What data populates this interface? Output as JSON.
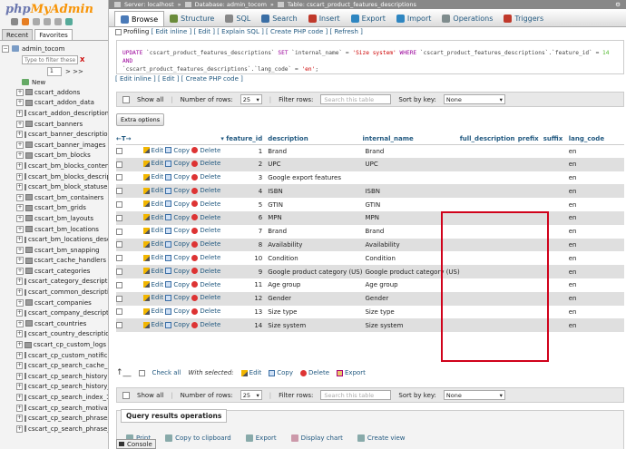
{
  "brand": {
    "name_a": "php",
    "name_b": "MyAdmin"
  },
  "nav": {
    "tabs": [
      "Recent",
      "Favorites"
    ],
    "db_name": "admin_tocom",
    "filter_placeholder": "Type to filter these, Ente",
    "filter_clear": "X",
    "page_select": "1",
    "page_next": "> >>",
    "new_label": "New",
    "tables": [
      "cscart_addons",
      "cscart_addon_data",
      "cscart_addon_descriptions",
      "cscart_banners",
      "cscart_banner_descriptions",
      "cscart_banner_images",
      "cscart_bm_blocks",
      "cscart_bm_blocks_content",
      "cscart_bm_blocks_descrip",
      "cscart_bm_block_statuses",
      "cscart_bm_containers",
      "cscart_bm_grids",
      "cscart_bm_layouts",
      "cscart_bm_locations",
      "cscart_bm_locations_desc",
      "cscart_bm_snapping",
      "cscart_cache_handlers",
      "cscart_categories",
      "cscart_category_descriptic",
      "cscart_common_descriptic",
      "cscart_companies",
      "cscart_company_descriptio",
      "cscart_countries",
      "cscart_country_descriptior",
      "cscart_cp_custom_logs",
      "cscart_cp_custom_notifica",
      "cscart_cp_search_cache_",
      "cscart_cp_search_history",
      "cscart_cp_search_history_",
      "cscart_cp_search_index_1",
      "cscart_cp_search_motivati",
      "cscart_cp_search_phrases",
      "cscart_cp_search_phrase_"
    ]
  },
  "breadcrumb": {
    "server": "Server: localhost",
    "database": "Database: admin_tocom",
    "table": "Table: cscart_product_features_descriptions",
    "sep": "»"
  },
  "tabs": [
    {
      "label": "Browse",
      "color": "#4a7ab8"
    },
    {
      "label": "Structure",
      "color": "#6a8b3a"
    },
    {
      "label": "SQL",
      "color": "#888888"
    },
    {
      "label": "Search",
      "color": "#3a6ea5"
    },
    {
      "label": "Insert",
      "color": "#c0392b"
    },
    {
      "label": "Export",
      "color": "#2e86c1"
    },
    {
      "label": "Import",
      "color": "#2e86c1"
    },
    {
      "label": "Operations",
      "color": "#7f8c8d"
    },
    {
      "label": "Triggers",
      "color": "#c0392b"
    }
  ],
  "profiling": {
    "label": "Profiling",
    "edit_inline": "[ Edit inline ]",
    "edit": "[ Edit ]",
    "explain": "[ Explain SQL ]",
    "create_php": "[ Create PHP code ]",
    "refresh": "[ Refresh ]"
  },
  "sql": {
    "l1_kw1": "UPDATE",
    "l1_tbl": " `cscart_product_features_descriptions` ",
    "l1_kw2": "SET",
    "l1_a": " `internal_name` = ",
    "l1_str": "'Size system'",
    "l1_b": " ",
    "l1_kw3": "WHERE",
    "l1_c": " `cscart_product_features_descriptions`.`feature_id` = ",
    "l1_num": "14",
    "l1_kw4": " AND",
    "l2_a": "`cscart_product_features_descriptions`.`lang_code` = ",
    "l2_str": "'en'",
    "l2_b": ";"
  },
  "sql_links": {
    "edit_inline": "[ Edit inline ]",
    "edit": "[ Edit ]",
    "create_php": "[ Create PHP code ]"
  },
  "controls": {
    "show_all": "Show all",
    "rows_label": "Number of rows:",
    "rows_value": "25",
    "filter_label": "Filter rows:",
    "filter_placeholder": "Search this table",
    "sort_label": "Sort by key:",
    "sort_value": "None"
  },
  "extra_options": "Extra options",
  "columns": {
    "arrows": "←T→",
    "feature_id": "feature_id",
    "description": "description",
    "internal_name": "internal_name",
    "full_description": "full_description",
    "prefix": "prefix",
    "suffix": "suffix",
    "lang_code": "lang_code"
  },
  "actions": {
    "edit": "Edit",
    "copy": "Copy",
    "delete": "Delete"
  },
  "rows": [
    {
      "id": "1",
      "description": "Brand",
      "internal_name": "Brand",
      "lang": "en"
    },
    {
      "id": "2",
      "description": "UPC",
      "internal_name": "UPC",
      "lang": "en"
    },
    {
      "id": "3",
      "description": "Google export features",
      "internal_name": "",
      "lang": "en"
    },
    {
      "id": "4",
      "description": "ISBN",
      "internal_name": "ISBN",
      "lang": "en"
    },
    {
      "id": "5",
      "description": "GTIN",
      "internal_name": "GTIN",
      "lang": "en"
    },
    {
      "id": "6",
      "description": "MPN",
      "internal_name": "MPN",
      "lang": "en"
    },
    {
      "id": "7",
      "description": "Brand",
      "internal_name": "Brand",
      "lang": "en"
    },
    {
      "id": "8",
      "description": "Availability",
      "internal_name": "Availability",
      "lang": "en"
    },
    {
      "id": "10",
      "description": "Condition",
      "internal_name": "Condition",
      "lang": "en"
    },
    {
      "id": "9",
      "description": "Google product category (US)",
      "internal_name": "Google product category (US)",
      "lang": "en"
    },
    {
      "id": "11",
      "description": "Age group",
      "internal_name": "Age group",
      "lang": "en"
    },
    {
      "id": "12",
      "description": "Gender",
      "internal_name": "Gender",
      "lang": "en"
    },
    {
      "id": "13",
      "description": "Size type",
      "internal_name": "Size type",
      "lang": "en"
    },
    {
      "id": "14",
      "description": "Size system",
      "internal_name": "Size system",
      "lang": "en"
    }
  ],
  "bulk": {
    "check_all": "Check all",
    "with_selected": "With selected:",
    "edit": "Edit",
    "copy": "Copy",
    "delete": "Delete",
    "export": "Export"
  },
  "qro": {
    "title": "Query results operations",
    "print": "Print",
    "clipboard": "Copy to clipboard",
    "export": "Export",
    "chart": "Display chart",
    "view": "Create view"
  },
  "console": "Console"
}
